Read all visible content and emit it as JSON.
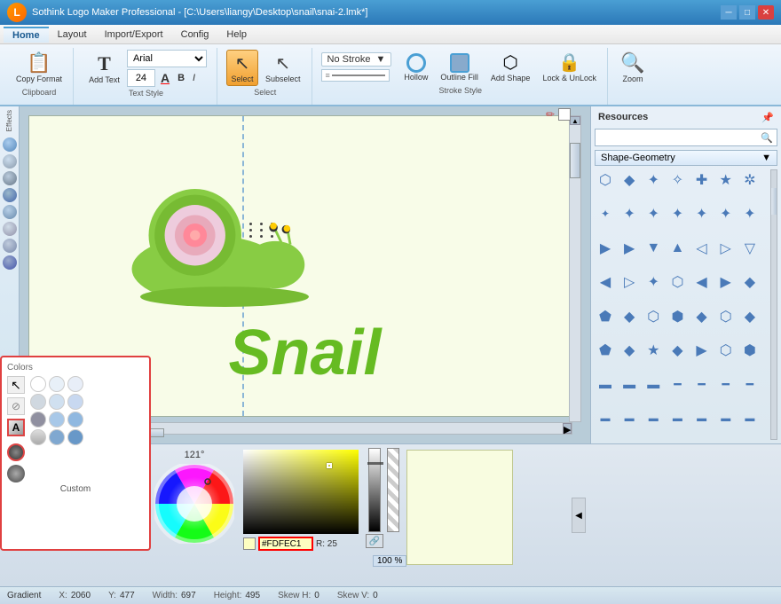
{
  "titlebar": {
    "title": "Sothink Logo Maker Professional - [C:\\Users\\liangy\\Desktop\\snail\\snai-2.lmk*]",
    "logo_text": "L"
  },
  "menubar": {
    "items": [
      "Home",
      "Layout",
      "Import/Export",
      "Config",
      "Help"
    ]
  },
  "ribbon": {
    "clipboard_group_label": "Clipboard",
    "copy_format_label": "Copy\nFormat",
    "text_style_group_label": "Text Style",
    "add_text_label": "Add\nText",
    "font_name": "Arial",
    "font_size": "24",
    "select_group_label": "Select",
    "select_label": "Select",
    "subselect_label": "Subselect",
    "stroke_style_group_label": "Stroke Style",
    "no_stroke_label": "No Stroke",
    "hollow_label": "Hollow",
    "outline_fill_label": "Outline\nFill",
    "add_shape_label": "Add\nShape",
    "lock_unlock_label": "Lock &\nUnLock",
    "zoom_label": "Zoom"
  },
  "effects_panel": {
    "label": "Effects",
    "circles": [
      "c1",
      "c2",
      "c3",
      "c4",
      "c5",
      "c6",
      "c7",
      "c8"
    ]
  },
  "resources_panel": {
    "label": "Resources",
    "search_placeholder": "",
    "dropdown_label": "Shape-Geometry",
    "shapes": [
      "⬡",
      "⬟",
      "✦",
      "✧",
      "⬠",
      "★",
      "⋆",
      "◆",
      "◈",
      "✦",
      "✦",
      "★",
      "🔷",
      "◀",
      "▶",
      "▶",
      "▼",
      "△",
      "◁",
      "▷",
      "▼",
      "◀",
      "▷",
      "✦",
      "✦",
      "⬡",
      "◀",
      "▶",
      "◆",
      "⬟",
      "◆",
      "⬡",
      "⬢",
      "◆",
      "⬡",
      "◆",
      "⬟",
      "◆",
      "★",
      "◆",
      "▶",
      "⬡",
      "⬢",
      "⬡",
      "⬢",
      "⬡",
      "⬢",
      "⬡",
      "▬",
      "▬",
      "▬",
      "▬",
      "▬",
      "▬",
      "▬",
      "▬",
      "▬",
      "▬",
      "▬",
      "▬",
      "▬",
      "▬",
      "▬"
    ]
  },
  "canvas": {
    "snail_text": "Snail"
  },
  "color_popup": {
    "title": "Colors",
    "custom_label": "Custom"
  },
  "color_controls": {
    "degree": "121°",
    "hex_value": "#FDFEC1",
    "r_label": "R: 25",
    "zoom_pct": "100 %"
  },
  "statusbar": {
    "gradient_label": "Gradient",
    "x_label": "X:",
    "x_val": "2060",
    "y_label": "Y:",
    "y_val": "477",
    "width_label": "Width:",
    "width_val": "697",
    "height_label": "Height:",
    "height_val": "495",
    "skew_h_label": "Skew H:",
    "skew_h_val": "0",
    "skew_v_label": "Skew V:",
    "skew_v_val": "0"
  }
}
